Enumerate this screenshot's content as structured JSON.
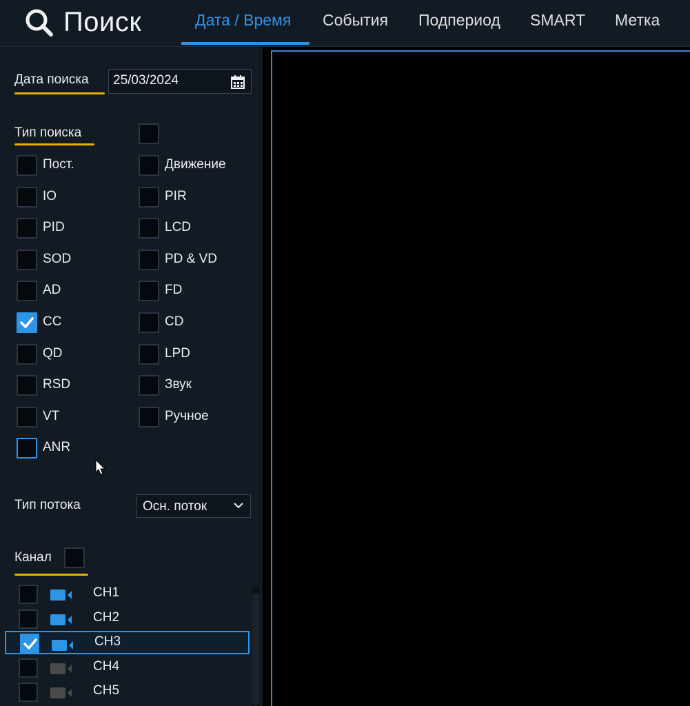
{
  "header": {
    "title": "Поиск",
    "tabs": [
      {
        "label": "Дата / Время",
        "active": true
      },
      {
        "label": "События",
        "active": false
      },
      {
        "label": "Подпериод",
        "active": false
      },
      {
        "label": "SMART",
        "active": false
      },
      {
        "label": "Метка",
        "active": false
      }
    ]
  },
  "search_date": {
    "label": "Дата поиска",
    "value": "25/03/2024"
  },
  "search_type": {
    "label": "Тип поиска",
    "select_all_checked": false,
    "left": [
      {
        "label": "Пост.",
        "checked": false
      },
      {
        "label": "IO",
        "checked": false
      },
      {
        "label": "PID",
        "checked": false
      },
      {
        "label": "SOD",
        "checked": false
      },
      {
        "label": "AD",
        "checked": false
      },
      {
        "label": "CC",
        "checked": true
      },
      {
        "label": "QD",
        "checked": false
      },
      {
        "label": "RSD",
        "checked": false
      },
      {
        "label": "VT",
        "checked": false
      },
      {
        "label": "ANR",
        "checked": false,
        "focused": true
      }
    ],
    "right": [
      {
        "label": "Движение",
        "checked": false
      },
      {
        "label": "PIR",
        "checked": false
      },
      {
        "label": "LCD",
        "checked": false
      },
      {
        "label": "PD & VD",
        "checked": false
      },
      {
        "label": "FD",
        "checked": false
      },
      {
        "label": "CD",
        "checked": false
      },
      {
        "label": "LPD",
        "checked": false
      },
      {
        "label": "Звук",
        "checked": false
      },
      {
        "label": "Ручное",
        "checked": false
      }
    ]
  },
  "stream_type": {
    "label": "Тип потока",
    "value": "Осн. поток"
  },
  "channel": {
    "label": "Канал",
    "select_all_checked": false,
    "items": [
      {
        "label": "CH1",
        "checked": false,
        "online": true
      },
      {
        "label": "CH2",
        "checked": false,
        "online": true
      },
      {
        "label": "CH3",
        "checked": true,
        "online": true,
        "selected": true
      },
      {
        "label": "CH4",
        "checked": false,
        "online": false
      },
      {
        "label": "CH5",
        "checked": false,
        "online": false
      }
    ]
  },
  "colors": {
    "accent": "#2e95e6",
    "underline": "#e8b100",
    "panel": "#121a23",
    "camera_offline": "#4a4a4a"
  }
}
